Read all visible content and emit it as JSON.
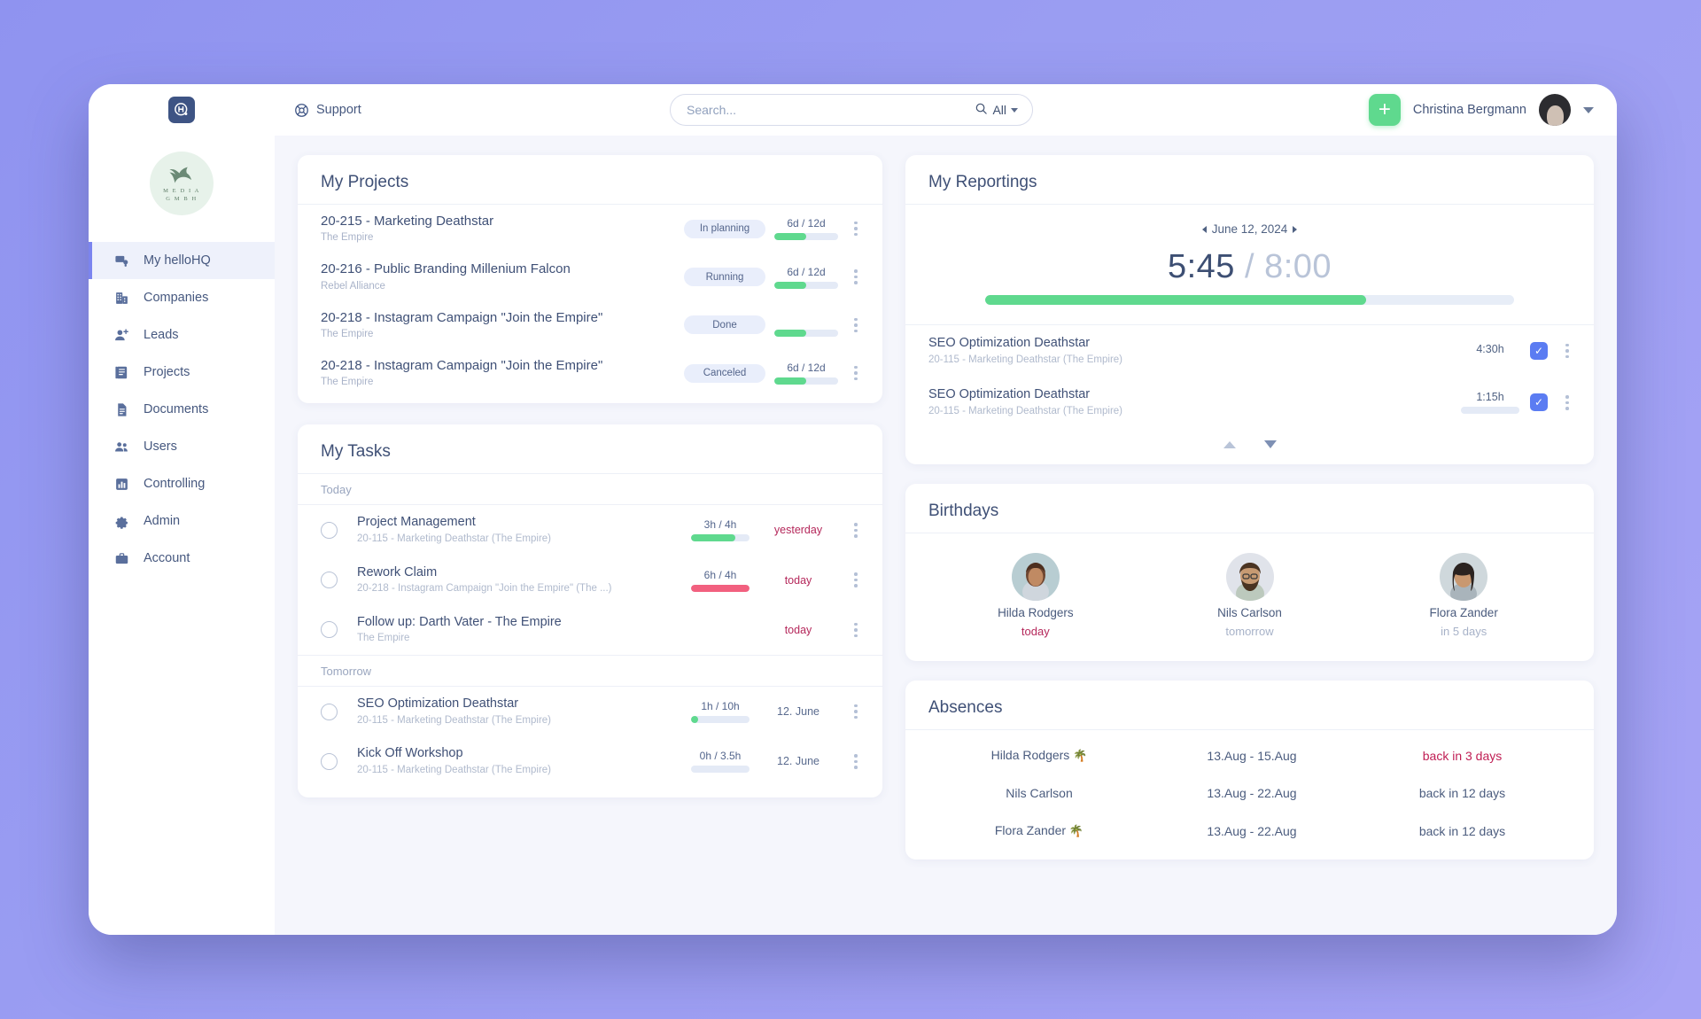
{
  "topbar": {
    "brand_icon": "hq-logo-icon",
    "support_label": "Support",
    "support_icon": "lifebuoy-icon",
    "search": {
      "placeholder": "Search...",
      "value": "",
      "scope_label": "All",
      "icon": "search-icon"
    },
    "add_button_label": "+",
    "user_name": "Christina Bergmann",
    "user_menu_icon": "chevron-down-icon"
  },
  "sidebar": {
    "company_logo": {
      "icon": "bird-logo-icon",
      "line1": "M E D I A",
      "line2": "G M B H"
    },
    "items": [
      {
        "label": "My helloHQ",
        "icon": "dashboard-icon",
        "active": true
      },
      {
        "label": "Companies",
        "icon": "building-icon",
        "active": false
      },
      {
        "label": "Leads",
        "icon": "user-plus-icon",
        "active": false
      },
      {
        "label": "Projects",
        "icon": "book-icon",
        "active": false
      },
      {
        "label": "Documents",
        "icon": "document-icon",
        "active": false
      },
      {
        "label": "Users",
        "icon": "users-icon",
        "active": false
      },
      {
        "label": "Controlling",
        "icon": "bar-chart-icon",
        "active": false
      },
      {
        "label": "Admin",
        "icon": "gear-icon",
        "active": false
      },
      {
        "label": "Account",
        "icon": "briefcase-icon",
        "active": false
      }
    ]
  },
  "projects": {
    "title": "My Projects",
    "rows": [
      {
        "name": "20-215 - Marketing  Deathstar",
        "client": "The Empire",
        "status": "In planning",
        "days": "6d / 12d",
        "progress_pct": 50
      },
      {
        "name": "20-216 - Public Branding Millenium Falcon",
        "client": "Rebel Alliance",
        "status": "Running",
        "days": "6d / 12d",
        "progress_pct": 50
      },
      {
        "name": "20-218 - Instagram Campaign \"Join the Empire\"",
        "client": "The Empire",
        "status": "Done",
        "days": "",
        "progress_pct": 50
      },
      {
        "name": "20-218 - Instagram Campaign \"Join the Empire\"",
        "client": "The Empire",
        "status": "Canceled",
        "days": "6d / 12d",
        "progress_pct": 50
      }
    ]
  },
  "tasks": {
    "title": "My Tasks",
    "groups": [
      {
        "label": "Today",
        "rows": [
          {
            "name": "Project Management",
            "sub": "20-115 - Marketing Deathstar (The Empire)",
            "hours": "3h / 4h",
            "progress_pct": 75,
            "bar_color": "#5fd98e",
            "date": "yesterday",
            "date_due": true
          },
          {
            "name": "Rework Claim",
            "sub": "20-218 - Instagram Campaign \"Join the Empire\" (The ...)",
            "hours": "6h / 4h",
            "progress_pct": 100,
            "bar_color": "#f2607f",
            "date": "today",
            "date_due": true
          },
          {
            "name": "Follow up: Darth Vater - The Empire",
            "sub": "The Empire",
            "hours": "",
            "progress_pct": 0,
            "bar_color": "",
            "date": "today",
            "date_due": true
          }
        ]
      },
      {
        "label": "Tomorrow",
        "rows": [
          {
            "name": "SEO Optimization Deathstar",
            "sub": "20-115 - Marketing Deathstar (The Empire)",
            "hours": "1h / 10h",
            "progress_pct": 12,
            "bar_color": "#5fd98e",
            "date": "12. June",
            "date_due": false
          },
          {
            "name": "Kick Off Workshop",
            "sub": "20-115 - Marketing Deathstar (The Empire)",
            "hours": "0h / 3.5h",
            "progress_pct": 0,
            "bar_color": "#5fd98e",
            "date": "12. June",
            "date_due": false
          }
        ]
      }
    ]
  },
  "reportings": {
    "title": "My Reportings",
    "date_label": "June 12, 2024",
    "prev_icon": "chevron-left-icon",
    "next_icon": "chevron-right-icon",
    "tracked": "5:45",
    "separator": "/",
    "target": "8:00",
    "progress_pct": 72,
    "rows": [
      {
        "name": "SEO Optimization Deathstar",
        "sub": "20-115 - Marketing Deathstar (The Empire)",
        "amount": "4:30h",
        "progress_pct": 0,
        "checked": true
      },
      {
        "name": "SEO Optimization Deathstar",
        "sub": "20-115 - Marketing Deathstar (The Empire)",
        "amount": "1:15h",
        "progress_pct": 0,
        "checked": true
      }
    ],
    "scroll_up_icon": "triangle-up-icon",
    "scroll_down_icon": "triangle-down-icon"
  },
  "birthdays": {
    "title": "Birthdays",
    "people": [
      {
        "name": "Hilda Rodgers",
        "when": "today",
        "highlight": true
      },
      {
        "name": "Nils Carlson",
        "when": "tomorrow",
        "highlight": false
      },
      {
        "name": "Flora Zander",
        "when": "in 5 days",
        "highlight": false
      }
    ]
  },
  "absences": {
    "title": "Absences",
    "rows": [
      {
        "name": "Hilda Rodgers",
        "palm": "🌴",
        "dates": "13.Aug - 15.Aug",
        "back": "back in 3 days",
        "urgent": true
      },
      {
        "name": "Nils Carlson",
        "palm": "",
        "dates": "13.Aug - 22.Aug",
        "back": "back in 12 days",
        "urgent": false
      },
      {
        "name": "Flora Zander",
        "palm": "🌴",
        "dates": "13.Aug - 22.Aug",
        "back": "back in 12 days",
        "urgent": false
      }
    ]
  },
  "colors": {
    "accent_green": "#5fd98e",
    "accent_blue": "#5b7cf2",
    "danger": "#b5285b",
    "text_dark": "#3f5076",
    "text_muted": "#a9b3c9"
  }
}
